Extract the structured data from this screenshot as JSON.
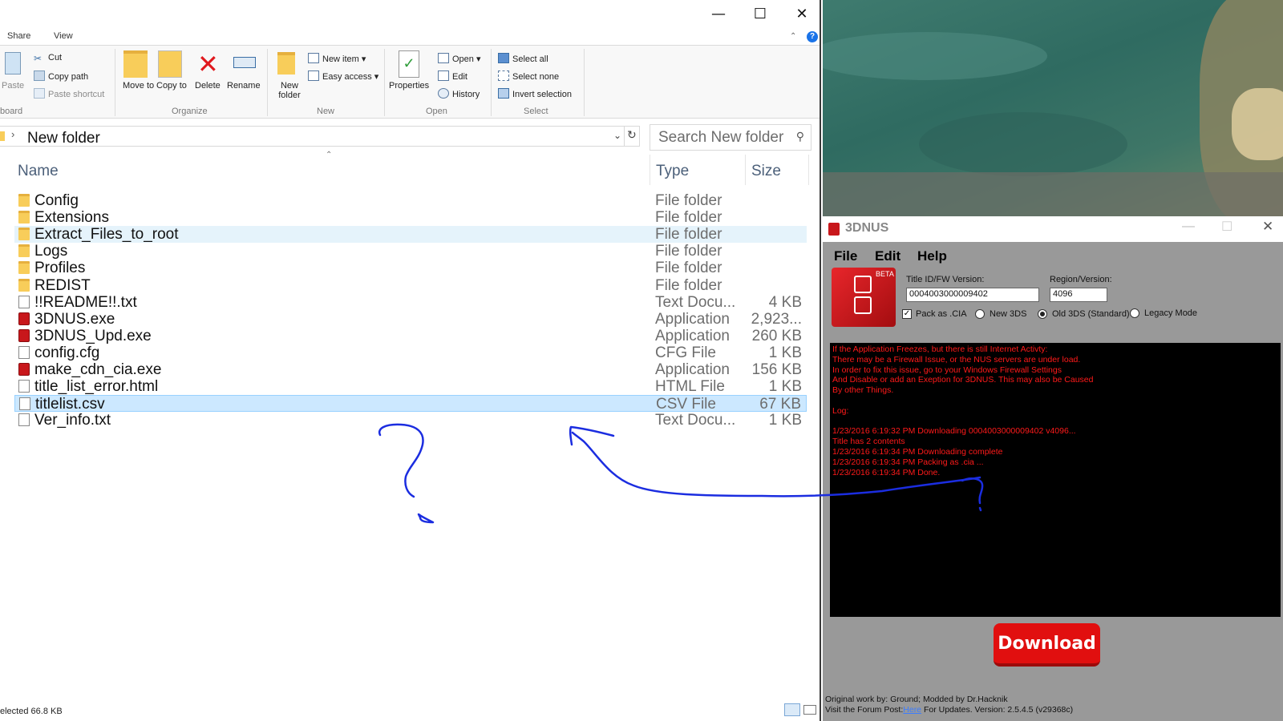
{
  "explorer": {
    "menu_tabs": [
      "Share",
      "View"
    ],
    "ribbon": {
      "clipboard": {
        "paste": "Paste",
        "cut": "Cut",
        "copy_path": "Copy path",
        "paste_shortcut": "Paste shortcut",
        "group": "board"
      },
      "organize": {
        "move_to": "Move to",
        "copy_to": "Copy to",
        "delete": "Delete",
        "rename": "Rename",
        "group": "Organize"
      },
      "new": {
        "new_folder": "New folder",
        "new_item": "New item",
        "easy_access": "Easy access",
        "group": "New"
      },
      "open": {
        "properties": "Properties",
        "open": "Open",
        "edit": "Edit",
        "history": "History",
        "group": "Open"
      },
      "select": {
        "select_all": "Select all",
        "select_none": "Select none",
        "invert_selection": "Invert selection",
        "group": "Select"
      }
    },
    "address": {
      "path": "New folder"
    },
    "search": {
      "placeholder": "Search New folder"
    },
    "columns": {
      "name": "Name",
      "type": "Type",
      "size": "Size"
    },
    "files": [
      {
        "name": "Config",
        "type": "File folder",
        "size": "",
        "icon": "folder-icon"
      },
      {
        "name": "Extensions",
        "type": "File folder",
        "size": "",
        "icon": "folder-icon"
      },
      {
        "name": "Extract_Files_to_root",
        "type": "File folder",
        "size": "",
        "icon": "folder-icon"
      },
      {
        "name": "Logs",
        "type": "File folder",
        "size": "",
        "icon": "folder-icon"
      },
      {
        "name": "Profiles",
        "type": "File folder",
        "size": "",
        "icon": "folder-icon"
      },
      {
        "name": "REDIST",
        "type": "File folder",
        "size": "",
        "icon": "folder-icon"
      },
      {
        "name": "!!README!!.txt",
        "type": "Text Docu...",
        "size": "4 KB",
        "icon": "text-file-icon"
      },
      {
        "name": "3DNUS.exe",
        "type": "Application",
        "size": "2,923...",
        "icon": "app-icon"
      },
      {
        "name": "3DNUS_Upd.exe",
        "type": "Application",
        "size": "260 KB",
        "icon": "app-icon"
      },
      {
        "name": "config.cfg",
        "type": "CFG File",
        "size": "1 KB",
        "icon": "cfg-file-icon"
      },
      {
        "name": "make_cdn_cia.exe",
        "type": "Application",
        "size": "156 KB",
        "icon": "app-icon"
      },
      {
        "name": "title_list_error.html",
        "type": "HTML File",
        "size": "1 KB",
        "icon": "html-file-icon"
      },
      {
        "name": "titlelist.csv",
        "type": "CSV File",
        "size": "67 KB",
        "icon": "csv-file-icon"
      },
      {
        "name": "Ver_info.txt",
        "type": "Text Docu...",
        "size": "1 KB",
        "icon": "text-file-icon"
      }
    ],
    "status": "elected  66.8 KB"
  },
  "nus": {
    "title": "3DNUS",
    "menu": [
      "File",
      "Edit",
      "Help"
    ],
    "beta": "BETA",
    "title_id_label": "Title ID/FW Version:",
    "title_id_value": "0004003000009402",
    "region_label": "Region/Version:",
    "region_value": "4096",
    "pack_cia": "Pack as .CIA",
    "new3ds": "New 3DS",
    "old3ds": "Old 3DS (Standard)",
    "legacy": "Legacy Mode",
    "log": [
      "If the Application Freezes, but there is still Internet Activty:",
      "There may be a Firewall Issue, or the NUS servers are under load.",
      "In order to fix this issue, go to your Windows Firewall Settings",
      "And Disable or add an Exeption for 3DNUS. This may also be Caused",
      "By other Things.",
      "",
      "Log:",
      "",
      "1/23/2016 6:19:32 PM Downloading 0004003000009402 v4096...",
      "Title has 2 contents",
      "1/23/2016 6:19:34 PM Downloading complete",
      "1/23/2016 6:19:34 PM Packing as .cia ...",
      "1/23/2016 6:19:34 PM Done."
    ],
    "download": "Download",
    "footer1": "Original work by: Ground; Modded by Dr.Hacknik",
    "footer2_a": "Visit the Forum Post:",
    "footer2_link": "Here",
    "footer2_b": "  For Updates.  Version: 2.5.4.5 (v29368c)"
  },
  "colors": {
    "accent": "#1a73e8",
    "red": "#e10f0f",
    "log_text": "#ff1a1a",
    "annotation": "#1b2de0"
  }
}
